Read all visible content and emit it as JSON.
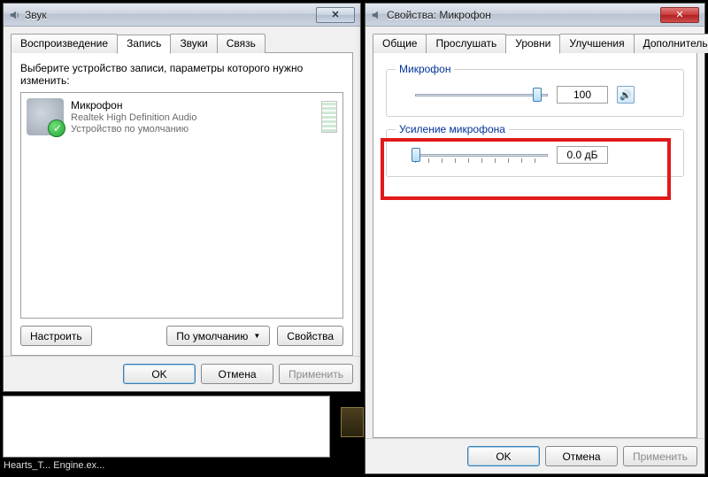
{
  "sound_dialog": {
    "title": "Звук",
    "tabs": {
      "playback": "Воспроизведение",
      "record": "Запись",
      "sounds": "Звуки",
      "comm": "Связь"
    },
    "active_tab": "record",
    "prompt": "Выберите устройство записи, параметры которого нужно изменить:",
    "device": {
      "name": "Микрофон",
      "driver": "Realtek High Definition Audio",
      "default": "Устройство по умолчанию"
    },
    "buttons": {
      "configure": "Настроить",
      "setdefault": "По умолчанию",
      "properties": "Свойства"
    },
    "footer": {
      "ok": "OK",
      "cancel": "Отмена",
      "apply": "Применить"
    }
  },
  "props_dialog": {
    "title": "Свойства: Микрофон",
    "tabs": {
      "general": "Общие",
      "listen": "Прослушать",
      "levels": "Уровни",
      "enhance": "Улучшения",
      "advanced": "Дополнительно"
    },
    "active_tab": "levels",
    "group_mic": {
      "legend": "Микрофон",
      "level": "100",
      "slider_pos_pct": 92
    },
    "group_boost": {
      "legend": "Усиление микрофона",
      "value": "0.0 дБ",
      "slider_pos_pct": 0
    },
    "footer": {
      "ok": "OK",
      "cancel": "Отмена",
      "apply": "Применить"
    }
  },
  "taskbar": {
    "label": "Hearts_T...   Engine.ex..."
  }
}
